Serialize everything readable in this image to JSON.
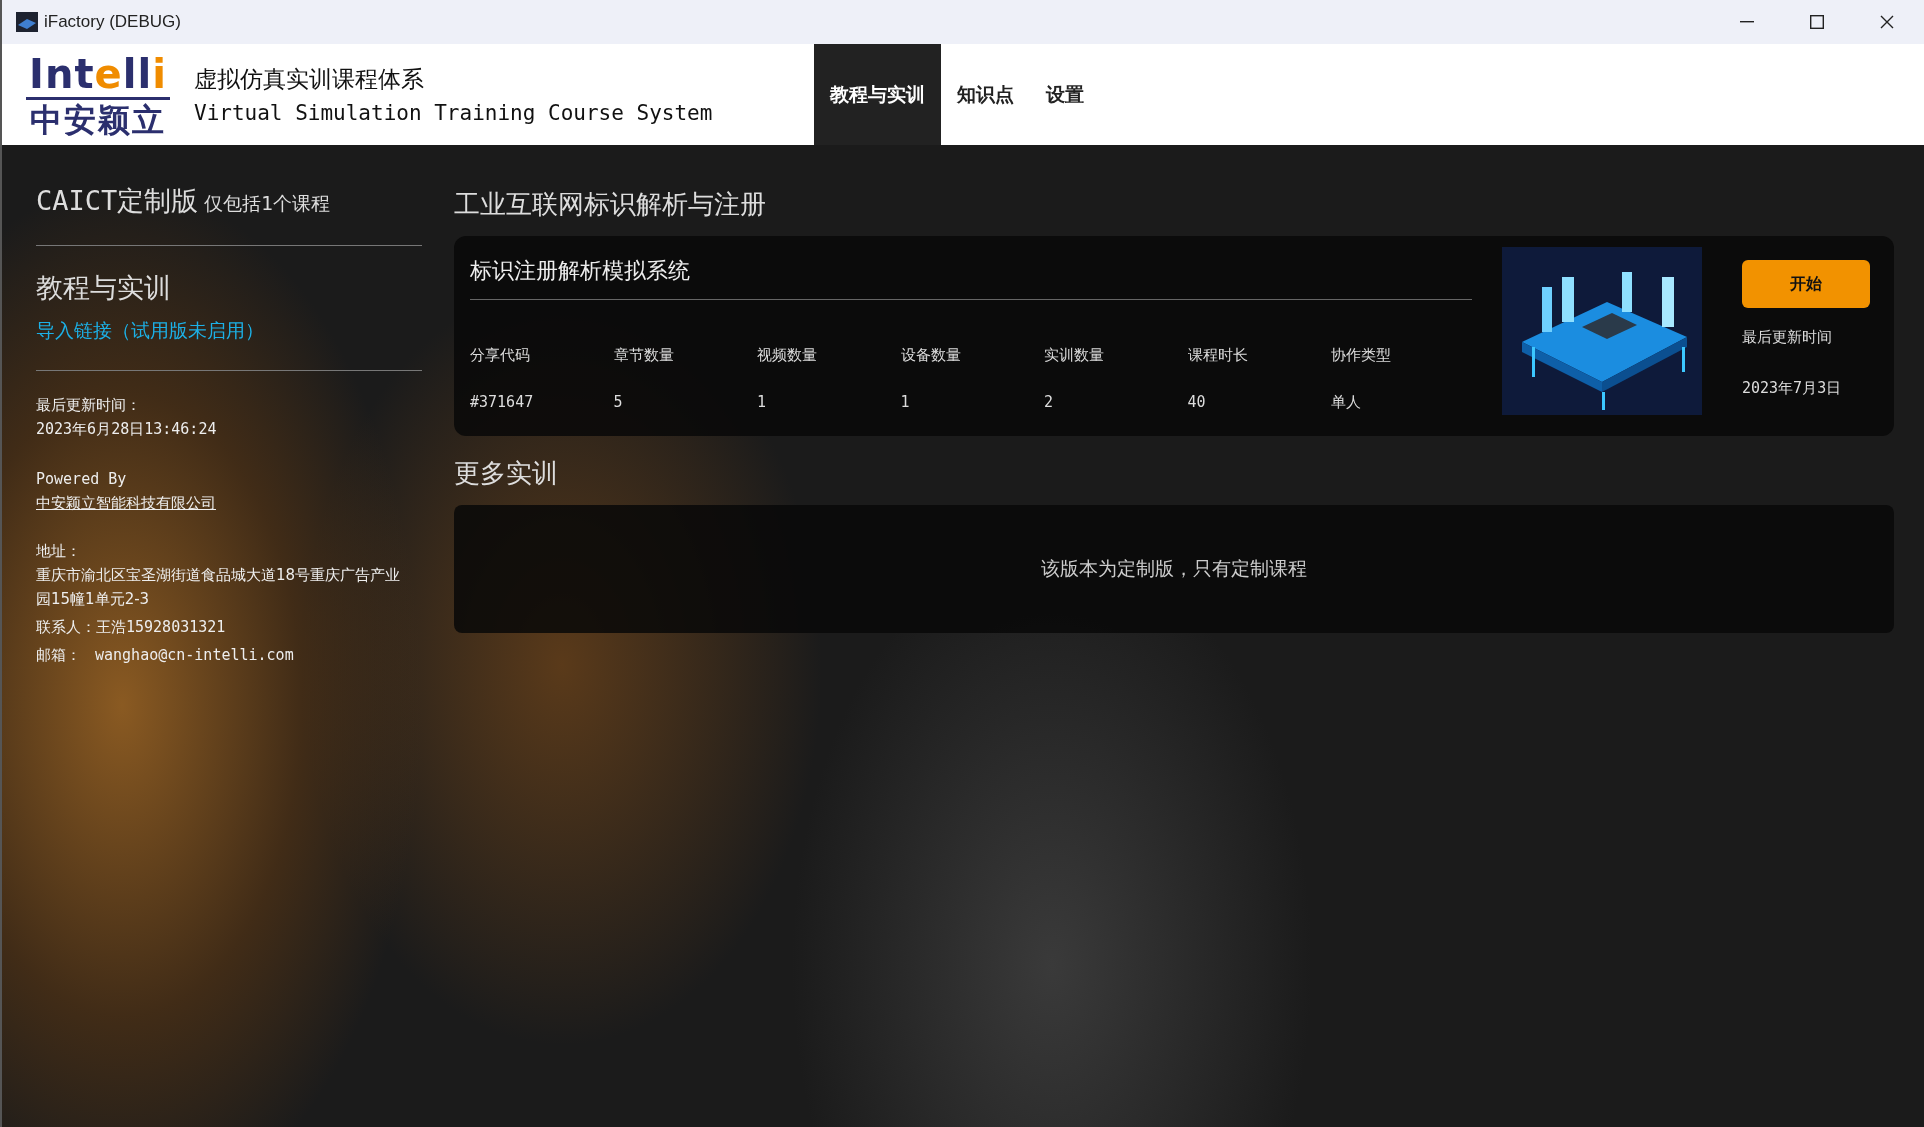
{
  "window": {
    "title": "iFactory (DEBUG)"
  },
  "header": {
    "logo": {
      "wordmark": [
        {
          "text": "Int",
          "accent": false
        },
        {
          "text": "e",
          "accent": true
        },
        {
          "text": "ll",
          "accent": false
        },
        {
          "text": "i",
          "accent": true
        }
      ],
      "subtitle": "中安颖立"
    },
    "title": "虚拟仿真实训课程体系",
    "subtitle": "Virtual Simulation Training Course System"
  },
  "tabs": [
    {
      "label": "教程与实训",
      "selected": true
    },
    {
      "label": "知识点",
      "selected": false
    },
    {
      "label": "设置",
      "selected": false
    }
  ],
  "sidebar": {
    "edition": "CAICT定制版",
    "edition_note": "仅包括1个课程",
    "section_title": "教程与实训",
    "import_link": "导入链接（试用版未启用）",
    "updated_label": "最后更新时间：",
    "updated_value": "2023年6月28日13:46:24",
    "powered_by": "Powered By",
    "company": "中安颖立智能科技有限公司",
    "address_label": "地址：",
    "address": "重庆市渝北区宝圣湖街道食品城大道18号重庆广告产业园15幢1单元2-3",
    "contact": "联系人：王浩15928031321",
    "email_label": "邮箱：",
    "email": "wanghao@cn-intelli.com"
  },
  "section_title": "工业互联网标识解析与注册",
  "course": {
    "title": "标识注册解析模拟系统",
    "stats": [
      {
        "label": "分享代码",
        "value": "#371647"
      },
      {
        "label": "章节数量",
        "value": "5"
      },
      {
        "label": "视频数量",
        "value": "1"
      },
      {
        "label": "设备数量",
        "value": "1"
      },
      {
        "label": "实训数量",
        "value": "2"
      },
      {
        "label": "课程时长",
        "value": "40"
      },
      {
        "label": "协作类型",
        "value": "单人"
      }
    ],
    "start_button": "开始",
    "updated_label": "最后更新时间",
    "updated_date": "2023年7月3日"
  },
  "more": {
    "title": "更多实训",
    "message": "该版本为定制版，只有定制课程"
  }
}
